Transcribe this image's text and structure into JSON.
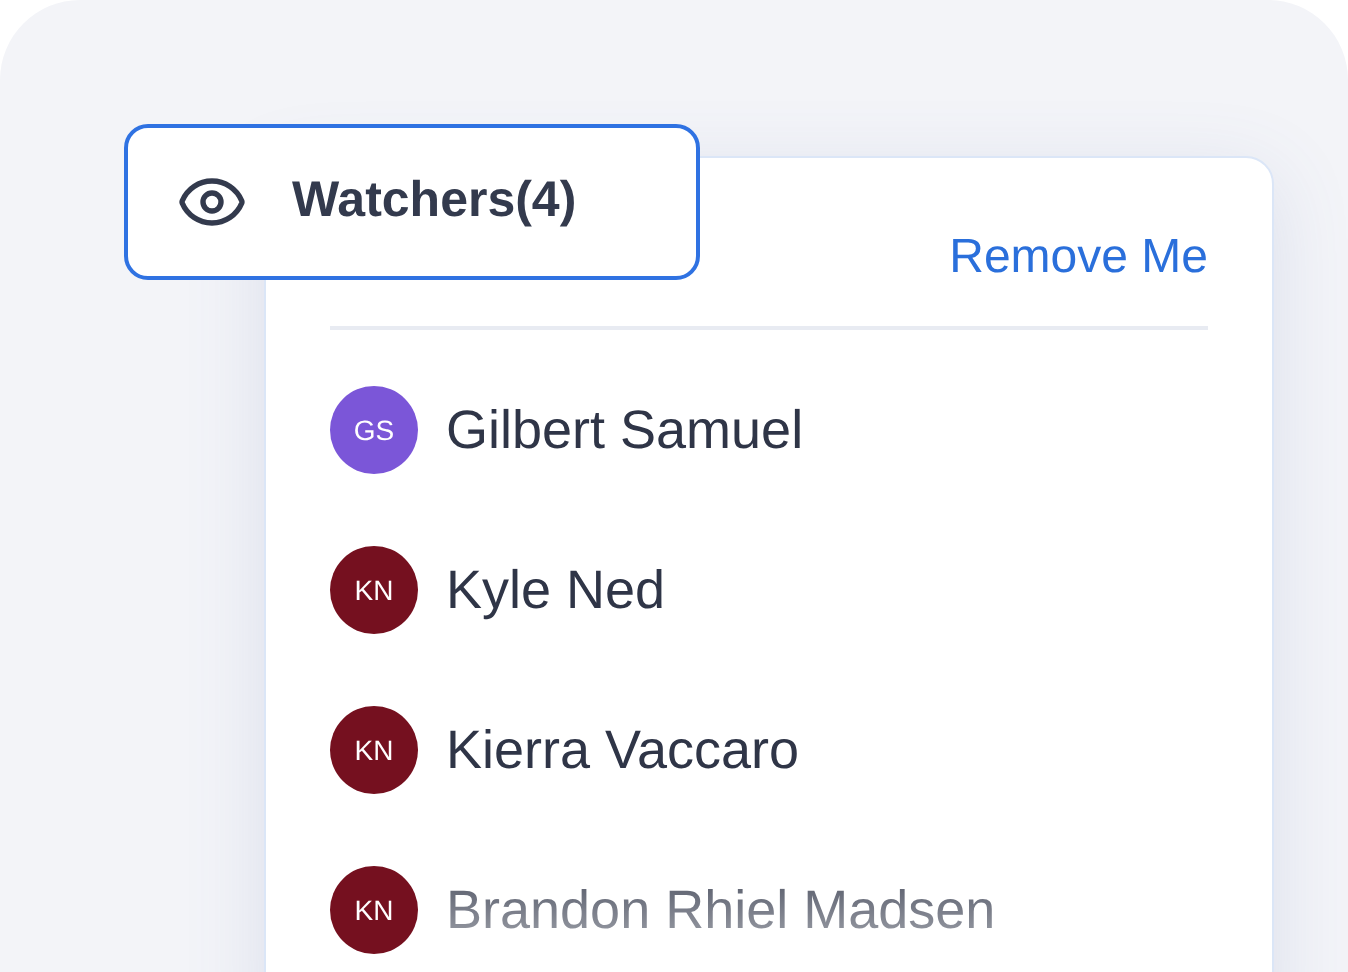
{
  "watchers_button": {
    "label": "Watchers(4)"
  },
  "remove_link": "Remove Me",
  "watchers": [
    {
      "initials": "GS",
      "name": "Gilbert Samuel",
      "color": "#7b56d8"
    },
    {
      "initials": "KN",
      "name": "Kyle Ned",
      "color": "#75101f"
    },
    {
      "initials": "KN",
      "name": "Kierra Vaccaro",
      "color": "#75101f"
    },
    {
      "initials": "KN",
      "name": "Brandon Rhiel Madsen",
      "color": "#75101f"
    }
  ]
}
